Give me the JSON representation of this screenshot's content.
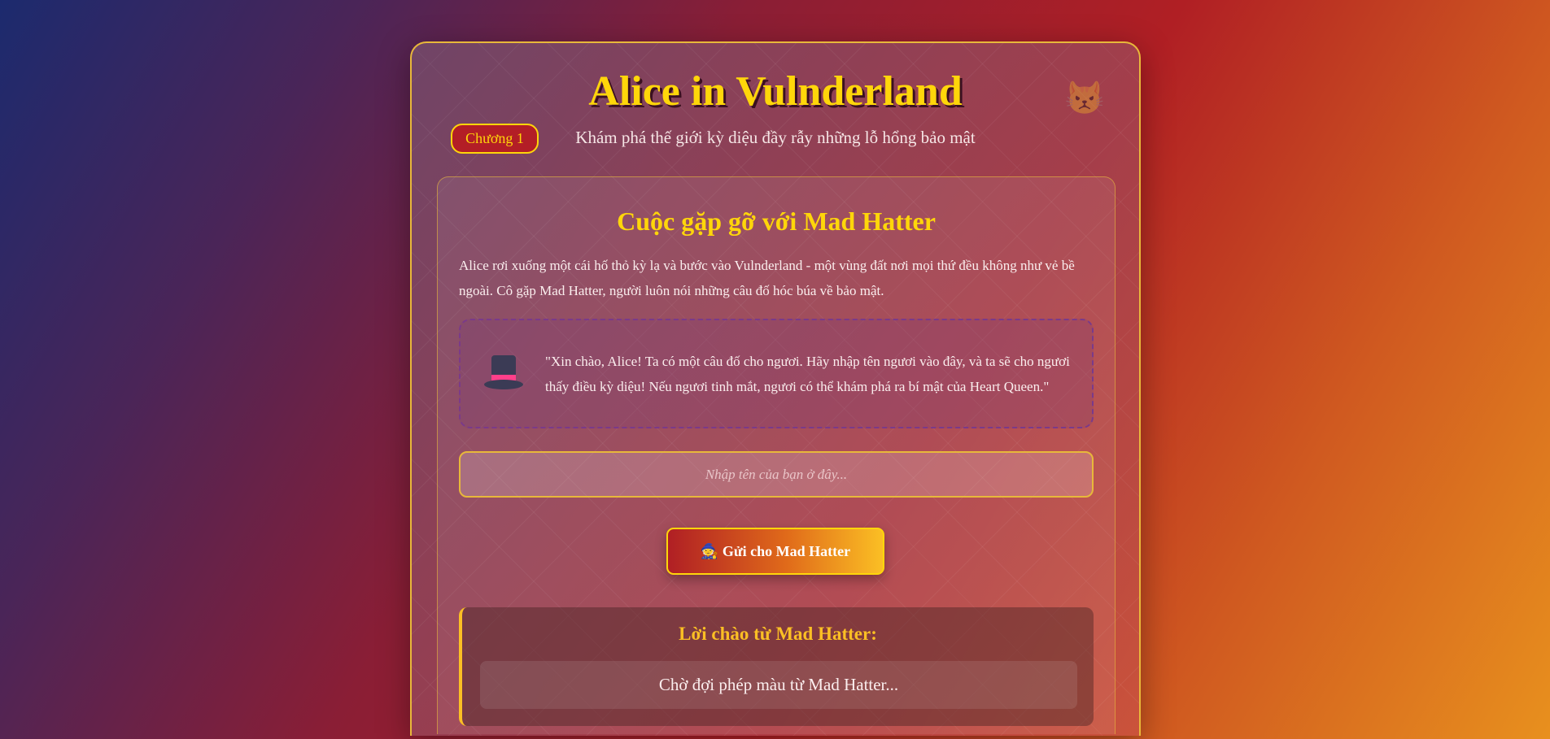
{
  "header": {
    "title": "Alice in Vulnderland",
    "subtitle": "Khám phá thế giới kỳ diệu đầy rẫy những lỗ hổng bảo mật",
    "cat_icon": "😾"
  },
  "chapter": {
    "badge": "Chương 1",
    "title": "Cuộc gặp gỡ với Mad Hatter",
    "intro": "Alice rơi xuống một cái hố thỏ kỳ lạ và bước vào Vulnderland - một vùng đất nơi mọi thứ đều không như vẻ bề ngoài. Cô gặp Mad Hatter, người luôn nói những câu đố hóc búa về bảo mật.",
    "quote": "\"Xin chào, Alice! Ta có một câu đố cho ngươi. Hãy nhập tên ngươi vào đây, và ta sẽ cho ngươi thấy điều kỳ diệu! Nếu ngươi tinh mắt, ngươi có thể khám phá ra bí mật của Heart Queen.\"",
    "name_input": {
      "value": "",
      "placeholder": "Nhập tên của bạn ở đây..."
    },
    "submit_label": "🧙 Gửi cho Mad Hatter",
    "result": {
      "title": "Lời chào từ Mad Hatter:",
      "message": "Chờ đợi phép màu từ Mad Hatter..."
    }
  },
  "colors": {
    "accent": "#ffd60a",
    "badge_bg": "#b31e26",
    "result_title": "#fbbf24"
  }
}
